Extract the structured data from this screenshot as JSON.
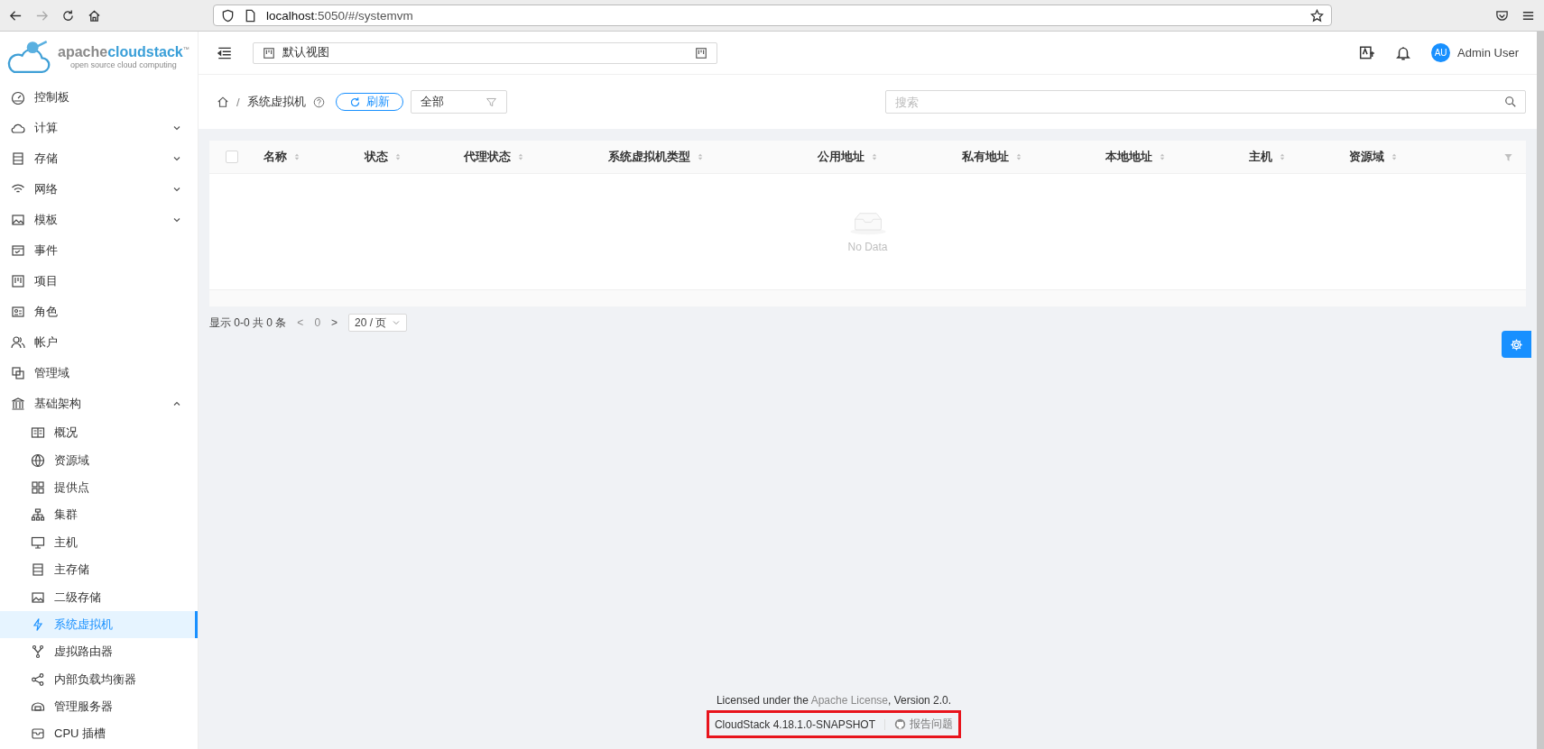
{
  "browser": {
    "url_host": "localhost",
    "url_rest": ":5050/#/systemvm"
  },
  "logo": {
    "brand_a": "apache",
    "brand_b": "cloudstack",
    "tm": "™",
    "tagline": "open source cloud computing"
  },
  "header": {
    "view_selector": "默认视图",
    "avatar": "AU",
    "user": "Admin User"
  },
  "sidebar": {
    "items": [
      {
        "label": "控制板",
        "selected": false
      },
      {
        "label": "计算",
        "selected": false,
        "expanded": false
      },
      {
        "label": "存储",
        "selected": false,
        "expanded": false
      },
      {
        "label": "网络",
        "selected": false,
        "expanded": false
      },
      {
        "label": "模板",
        "selected": false,
        "expanded": false
      },
      {
        "label": "事件",
        "selected": false
      },
      {
        "label": "项目",
        "selected": false
      },
      {
        "label": "角色",
        "selected": false
      },
      {
        "label": "帐户",
        "selected": false
      },
      {
        "label": "管理域",
        "selected": false
      },
      {
        "label": "基础架构",
        "selected": false,
        "expanded": true,
        "children": [
          {
            "label": "概况",
            "selected": false
          },
          {
            "label": "资源域",
            "selected": false
          },
          {
            "label": "提供点",
            "selected": false
          },
          {
            "label": "集群",
            "selected": false
          },
          {
            "label": "主机",
            "selected": false
          },
          {
            "label": "主存储",
            "selected": false
          },
          {
            "label": "二级存储",
            "selected": false
          },
          {
            "label": "系统虚拟机",
            "selected": true
          },
          {
            "label": "虚拟路由器",
            "selected": false
          },
          {
            "label": "内部负载均衡器",
            "selected": false
          },
          {
            "label": "管理服务器",
            "selected": false
          },
          {
            "label": "CPU 插槽",
            "selected": false
          }
        ]
      }
    ]
  },
  "toolbar": {
    "separator": "/",
    "title": "系统虚拟机",
    "refresh": "刷新",
    "filter": "全部",
    "search": {
      "placeholder": "搜索"
    }
  },
  "table": {
    "select_all_checked": false,
    "columns": [
      {
        "label": "名称",
        "sortable": true
      },
      {
        "label": "状态",
        "sortable": true
      },
      {
        "label": "代理状态",
        "sortable": true
      },
      {
        "label": "系统虚拟机类型",
        "sortable": true
      },
      {
        "label": "公用地址",
        "sortable": true
      },
      {
        "label": "私有地址",
        "sortable": true
      },
      {
        "label": "本地地址",
        "sortable": true
      },
      {
        "label": "主机",
        "sortable": true
      },
      {
        "label": "资源域",
        "sortable": true
      }
    ],
    "empty_text": "No Data"
  },
  "pagination": {
    "summary": "显示 0-0 共 0 条",
    "prev": "<",
    "page": "0",
    "next": ">",
    "page_size": "20 / 页"
  },
  "footer": {
    "license_before": "Licensed under the ",
    "license_link": "Apache License",
    "license_after": ", Version 2.0.",
    "version": "CloudStack 4.18.1.0-SNAPSHOT",
    "report": "报告问题",
    "highlighted": true
  }
}
